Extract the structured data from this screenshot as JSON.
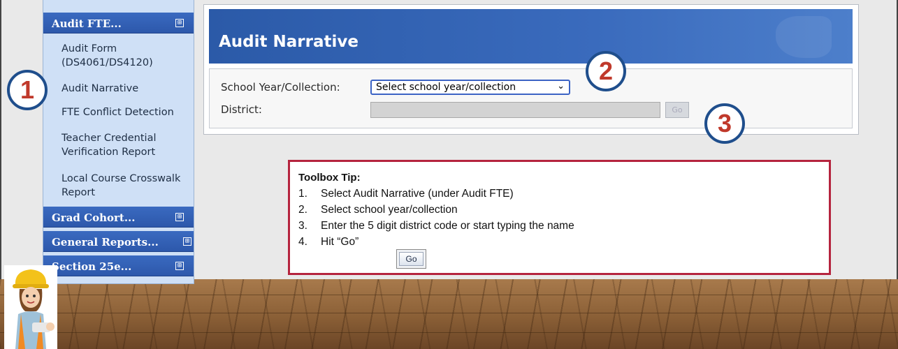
{
  "sidebar": {
    "sections": [
      {
        "label": "Audit FTE..."
      },
      {
        "label": "Grad Cohort..."
      },
      {
        "label": "General Reports..."
      },
      {
        "label": "Section 25e..."
      }
    ],
    "expand_symbol": "⊞",
    "audit_items": [
      {
        "line1": "Audit Form",
        "line2": "(DS4061/DS4120)"
      },
      {
        "line1": "Audit Narrative",
        "line2": ""
      },
      {
        "line1": "FTE Conflict Detection",
        "line2": ""
      },
      {
        "line1": "Teacher Credential",
        "line2": "Verification Report"
      },
      {
        "line1": "Local Course Crosswalk",
        "line2": "Report"
      }
    ]
  },
  "main": {
    "title": "Audit Narrative",
    "school_year_label": "School Year/Collection:",
    "school_year_value": "Select school year/collection",
    "district_label": "District:",
    "go_label": "Go"
  },
  "callouts": [
    "1",
    "2",
    "3"
  ],
  "tip": {
    "title": "Toolbox Tip:",
    "steps": [
      {
        "num": "1.",
        "text": "Select Audit Narrative (under Audit FTE)"
      },
      {
        "num": "2.",
        "text": "Select school year/collection"
      },
      {
        "num": "3.",
        "text": "Enter the 5 digit district code or start typing the name"
      },
      {
        "num": "4.",
        "text": "Hit “Go”"
      }
    ],
    "go_sample_label": "Go"
  },
  "colors": {
    "header_blue": "#2d58ab",
    "sidebar_bg": "#cfe0f6",
    "callout_ring": "#1f4e8c",
    "callout_digit": "#c0392b",
    "tip_border": "#b5243e"
  }
}
